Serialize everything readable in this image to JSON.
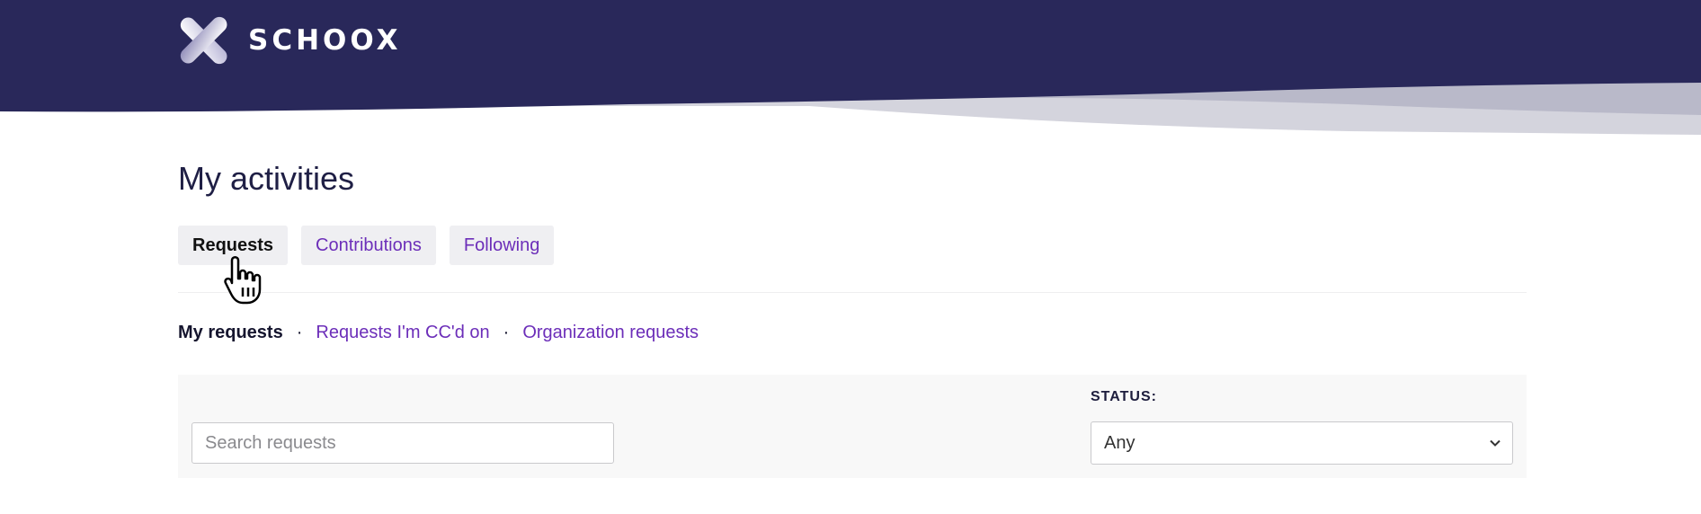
{
  "brand": {
    "name": "SCHOOX",
    "header_color": "#29285a"
  },
  "page": {
    "title": "My activities"
  },
  "tabs": [
    {
      "label": "Requests",
      "active": true
    },
    {
      "label": "Contributions",
      "active": false
    },
    {
      "label": "Following",
      "active": false
    }
  ],
  "subnav": [
    {
      "label": "My requests",
      "active": true
    },
    {
      "label": "Requests I'm CC'd on",
      "active": false
    },
    {
      "label": "Organization requests",
      "active": false
    }
  ],
  "filters": {
    "search_placeholder": "Search requests",
    "search_value": "",
    "status_label": "STATUS:",
    "status_selected": "Any"
  },
  "colors": {
    "link": "#6c2eb9",
    "panel_bg": "#f8f8f8"
  },
  "icons": {
    "logo": "schoox-logo-icon",
    "select_chevron": "chevron-down-icon",
    "pointer": "hand-pointer-icon"
  }
}
